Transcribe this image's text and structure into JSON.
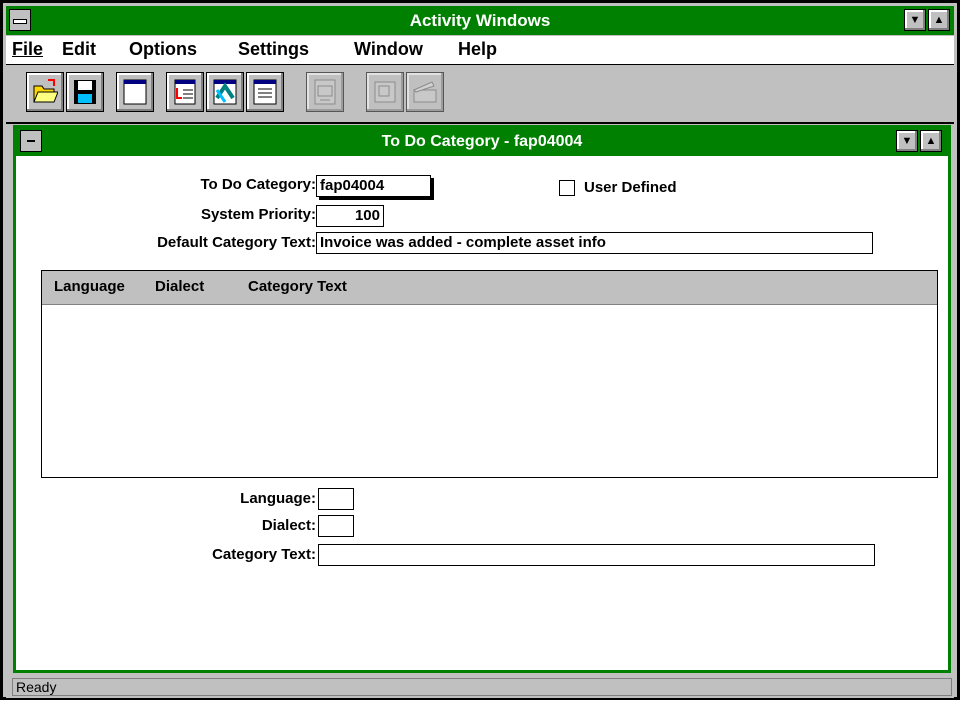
{
  "app": {
    "title": "Activity Windows"
  },
  "menu": {
    "file": "File",
    "edit": "Edit",
    "options": "Options",
    "settings": "Settings",
    "window": "Window",
    "help": "Help"
  },
  "toolbar": {
    "buttons": [
      {
        "icon": "open-folder-icon",
        "enabled": true
      },
      {
        "icon": "save-disk-icon",
        "enabled": true
      },
      {
        "icon": "new-window-icon",
        "enabled": true
      },
      {
        "icon": "form-import-icon",
        "enabled": true
      },
      {
        "icon": "refresh-arrows-icon",
        "enabled": true
      },
      {
        "icon": "list-view-icon",
        "enabled": true
      },
      {
        "icon": "document-transfer-icon",
        "enabled": false
      },
      {
        "icon": "print-icon",
        "enabled": false
      },
      {
        "icon": "clapperboard-icon",
        "enabled": false
      }
    ]
  },
  "child": {
    "title": "To Do Category -  fap04004"
  },
  "form": {
    "todo_category_label": "To Do Category:",
    "todo_category_value": "fap04004",
    "user_defined_label": "User Defined",
    "user_defined_checked": false,
    "system_priority_label": "System Priority:",
    "system_priority_value": "100",
    "default_text_label": "Default Category Text:",
    "default_text_value": "Invoice was added - complete asset info",
    "language_label": "Language:",
    "language_value": "",
    "dialect_label": "Dialect:",
    "dialect_value": "",
    "category_text_label": "Category Text:",
    "category_text_value": ""
  },
  "grid": {
    "columns": [
      "Language",
      "Dialect",
      "Category Text"
    ],
    "rows": []
  },
  "status": {
    "text": "Ready"
  }
}
